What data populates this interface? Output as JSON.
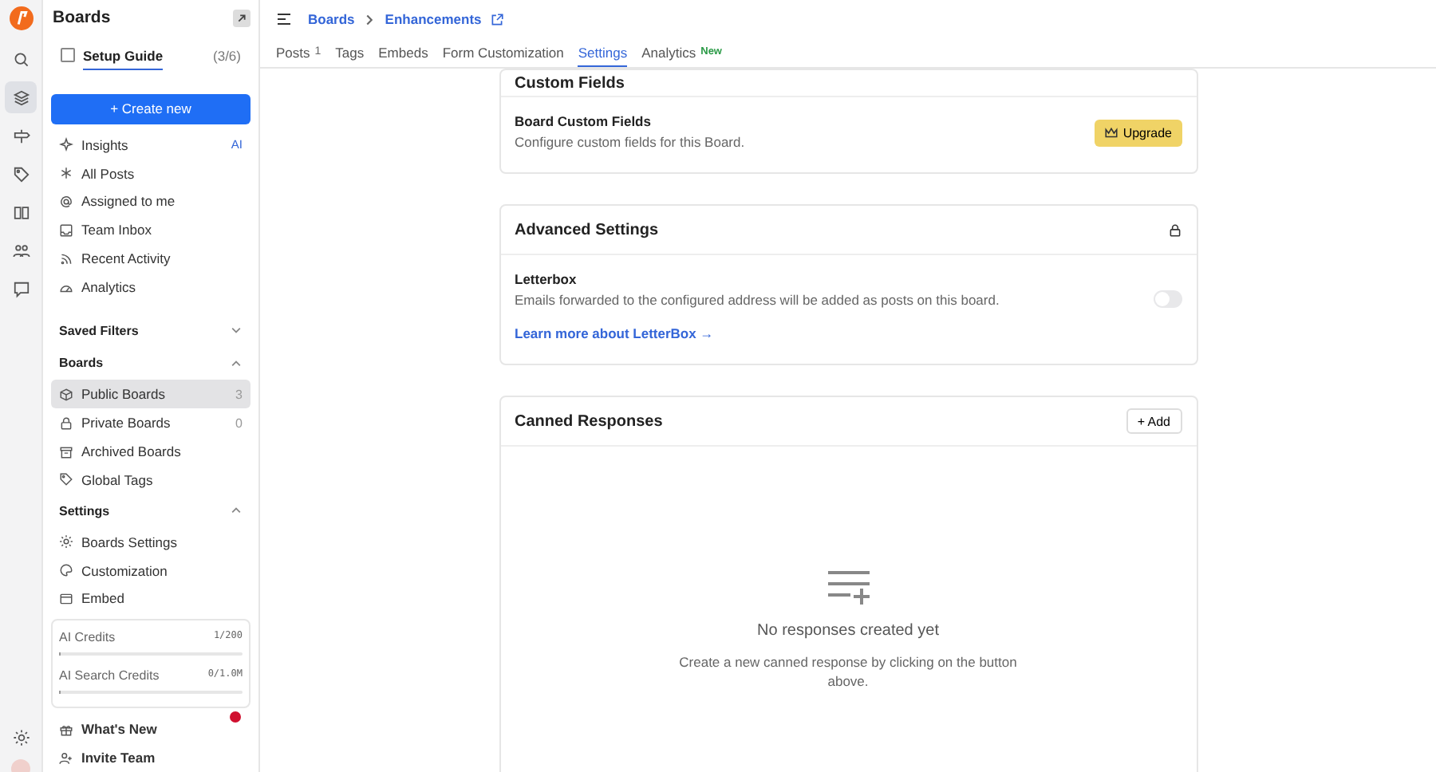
{
  "rail": {
    "items": [
      {
        "selected": false
      },
      {
        "selected": true
      },
      {
        "selected": false
      },
      {
        "selected": false
      },
      {
        "selected": false
      },
      {
        "selected": false
      },
      {
        "selected": false
      }
    ]
  },
  "sidebar": {
    "title": "Boards",
    "setup_guide": {
      "label": "Setup Guide",
      "progress": "(3/6)",
      "checked": false
    },
    "create_button": "+ Create new",
    "nav": [
      {
        "label": "Insights",
        "badge": "AI"
      },
      {
        "label": "All Posts"
      },
      {
        "label": "Assigned to me"
      },
      {
        "label": "Team Inbox"
      },
      {
        "label": "Recent Activity"
      },
      {
        "label": "Analytics"
      }
    ],
    "sections": [
      {
        "title": "Saved Filters",
        "expanded": false
      },
      {
        "title": "Boards",
        "expanded": true,
        "items": [
          {
            "label": "Public Boards",
            "count": "3",
            "selected": true
          },
          {
            "label": "Private Boards",
            "count": "0",
            "selected": false
          },
          {
            "label": "Archived Boards",
            "selected": false
          },
          {
            "label": "Global Tags",
            "selected": false
          }
        ]
      },
      {
        "title": "Settings",
        "expanded": true,
        "items": [
          {
            "label": "Boards Settings",
            "selected": false
          },
          {
            "label": "Customization",
            "selected": false
          },
          {
            "label": "Embed",
            "selected": false
          }
        ]
      }
    ],
    "credits": [
      {
        "label": "AI Credits",
        "value": "1/200",
        "level": 0.005
      },
      {
        "label": "AI Search Credits",
        "value": "0/1.0M",
        "level": 0
      }
    ],
    "footer": [
      {
        "label": "What's New",
        "notification": true
      },
      {
        "label": "Invite Team",
        "notification": false
      }
    ]
  },
  "header": {
    "breadcrumb": [
      "Boards",
      "Enhancements"
    ],
    "tabs": [
      {
        "label": "Posts",
        "count": "1",
        "selected": false
      },
      {
        "label": "Tags",
        "selected": false
      },
      {
        "label": "Embeds",
        "selected": false
      },
      {
        "label": "Form Customization",
        "selected": false
      },
      {
        "label": "Settings",
        "selected": true
      },
      {
        "label": "Analytics",
        "badge": "New",
        "selected": false
      }
    ]
  },
  "cards": [
    {
      "kind": "custom_fields",
      "title": "Custom Fields",
      "row_title": "Board Custom Fields",
      "row_text": "Configure custom fields for this Board.",
      "button": "Upgrade"
    },
    {
      "kind": "advanced",
      "title": "Advanced Settings",
      "row_title": "Letterbox",
      "row_text": "Emails forwarded to the configured address will be added as posts on this board.",
      "on": false,
      "link": "Learn more about LetterBox →"
    },
    {
      "kind": "canned",
      "title": "Canned Responses",
      "button": "+ Add",
      "empty_title": "No responses created yet",
      "empty_text": "Create a new canned response by clicking on the button above."
    }
  ]
}
